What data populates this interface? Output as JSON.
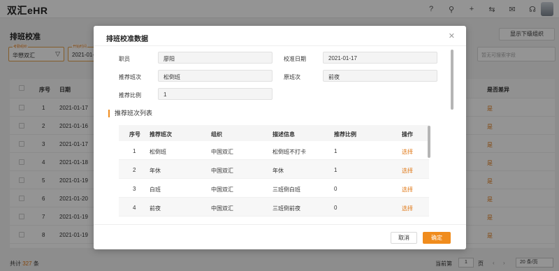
{
  "app": {
    "logo": "双汇eHR"
  },
  "topbar": {
    "icons": [
      "help-icon",
      "search-icon",
      "plus-icon",
      "translate-icon",
      "mail-icon",
      "headset-icon"
    ],
    "glyphs": [
      "?",
      "⚲",
      "+",
      "⇆",
      "✉",
      "☊"
    ]
  },
  "page": {
    "title": "排班校准",
    "show_sub_org_button": "显示下级组织",
    "filters": [
      {
        "label": "考勤组织",
        "value": "华懋双汇"
      },
      {
        "label": "开始时间",
        "value": "2021-01-..."
      }
    ],
    "search_placeholder": "暂无可搜索字段"
  },
  "bg_table": {
    "headers": {
      "seq": "序号",
      "date": "日期",
      "diff": "是否差异"
    },
    "rows": [
      {
        "seq": "1",
        "date": "2021-01-17",
        "diff": "是"
      },
      {
        "seq": "2",
        "date": "2021-01-16",
        "diff": "是"
      },
      {
        "seq": "3",
        "date": "2021-01-17",
        "diff": "是"
      },
      {
        "seq": "4",
        "date": "2021-01-18",
        "diff": "是"
      },
      {
        "seq": "5",
        "date": "2021-01-19",
        "diff": "是"
      },
      {
        "seq": "6",
        "date": "2021-01-20",
        "diff": "是"
      },
      {
        "seq": "7",
        "date": "2021-01-19",
        "diff": "是"
      },
      {
        "seq": "8",
        "date": "2021-01-19",
        "diff": "是"
      }
    ]
  },
  "pagination": {
    "total_prefix": "共计",
    "total_count": "327",
    "total_suffix": "条",
    "current_label": "当前第",
    "current_page": "1",
    "page_unit": "页",
    "page_size": "20 条/页"
  },
  "modal": {
    "title": "排班校准数据",
    "fields": {
      "employee_label": "职员",
      "employee_value": "廖阳",
      "date_label": "校准日期",
      "date_value": "2021-01-17",
      "recommended_label": "推荐班次",
      "recommended_value": "松倒班",
      "original_label": "原班次",
      "original_value": "前夜",
      "ratio_label": "推荐比例",
      "ratio_value": "1"
    },
    "section_title": "推荐班次列表",
    "table": {
      "headers": {
        "seq": "序号",
        "shift": "推荐班次",
        "org": "组织",
        "desc": "描述信息",
        "ratio": "推荐比例",
        "action": "操作"
      },
      "rows": [
        {
          "seq": "1",
          "shift": "松倒班",
          "org": "中国双汇",
          "desc": "松倒班不打卡",
          "ratio": "1",
          "action": "选择"
        },
        {
          "seq": "2",
          "shift": "年休",
          "org": "中国双汇",
          "desc": "年休",
          "ratio": "1",
          "action": "选择"
        },
        {
          "seq": "3",
          "shift": "白班",
          "org": "中国双汇",
          "desc": "三班倒白班",
          "ratio": "0",
          "action": "选择"
        },
        {
          "seq": "4",
          "shift": "前夜",
          "org": "中国双汇",
          "desc": "三班倒前夜",
          "ratio": "0",
          "action": "选择"
        }
      ]
    },
    "cancel_label": "取消",
    "ok_label": "确定"
  },
  "colors": {
    "accent": "#f08c1d",
    "accent_text": "#e07a1a"
  }
}
